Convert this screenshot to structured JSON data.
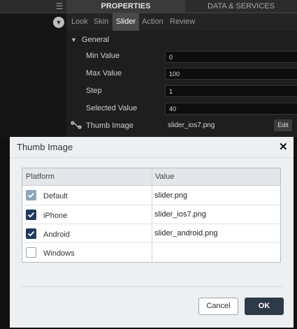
{
  "header": {
    "properties_tab": "PROPERTIES",
    "data_services_tab": "DATA & SERVICES"
  },
  "subtabs": [
    "Look",
    "Skin",
    "Slider",
    "Action",
    "Review"
  ],
  "active_subtab": "Slider",
  "properties": {
    "section": "General",
    "min_value": {
      "label": "Min Value",
      "value": "0"
    },
    "max_value": {
      "label": "Max Value",
      "value": "100"
    },
    "step": {
      "label": "Step",
      "value": "1"
    },
    "selected_value": {
      "label": "Selected Value",
      "value": "40"
    },
    "thumb_image": {
      "label": "Thumb Image",
      "value": "slider_ios7.png",
      "edit_label": "Edit"
    }
  },
  "dialog": {
    "title": "Thumb Image",
    "close_symbol": "✕",
    "columns": [
      "Platform",
      "Value"
    ],
    "rows": [
      {
        "platform": "Default",
        "value": "slider.png",
        "checked": true,
        "disabled": true
      },
      {
        "platform": "iPhone",
        "value": "slider_ios7.png",
        "checked": true,
        "disabled": false
      },
      {
        "platform": "Android",
        "value": "slider_android.png",
        "checked": true,
        "disabled": false
      },
      {
        "platform": "Windows",
        "value": "",
        "checked": false,
        "disabled": false
      }
    ],
    "cancel_label": "Cancel",
    "ok_label": "OK"
  },
  "colors": {
    "checkbox_checked": "#1f3a5f",
    "checkbox_disabled": "#8a9fb8",
    "ok_button": "#2d3a48"
  }
}
